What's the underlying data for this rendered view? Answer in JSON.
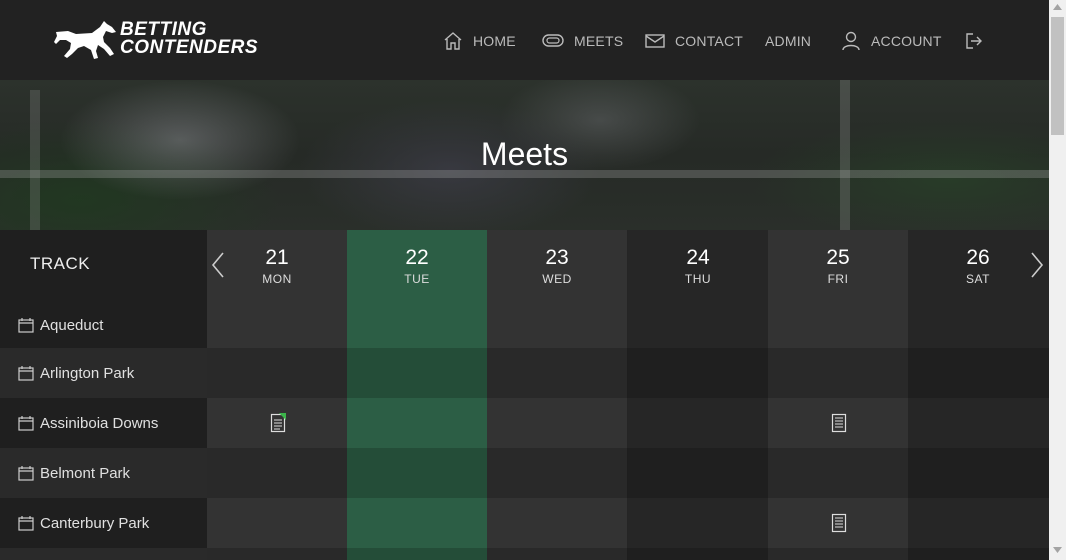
{
  "brand": {
    "line1": "BETTING",
    "line2": "CONTENDERS"
  },
  "nav": {
    "home": "HOME",
    "meets": "MEETS",
    "contact": "CONTACT",
    "admin": "ADMIN",
    "account": "ACCOUNT"
  },
  "hero": {
    "title": "Meets"
  },
  "calendar": {
    "track_header": "TRACK",
    "days": [
      {
        "num": "21",
        "name": "MON"
      },
      {
        "num": "22",
        "name": "TUE"
      },
      {
        "num": "23",
        "name": "WED"
      },
      {
        "num": "24",
        "name": "THU"
      },
      {
        "num": "25",
        "name": "FRI"
      },
      {
        "num": "26",
        "name": "SAT"
      }
    ],
    "tracks": [
      {
        "name": "Aqueduct"
      },
      {
        "name": "Arlington Park"
      },
      {
        "name": "Assiniboia Downs"
      },
      {
        "name": "Belmont Park"
      },
      {
        "name": "Canterbury Park"
      }
    ]
  },
  "colors": {
    "today": "#2c5e45",
    "accent_green": "#3cb54a"
  }
}
